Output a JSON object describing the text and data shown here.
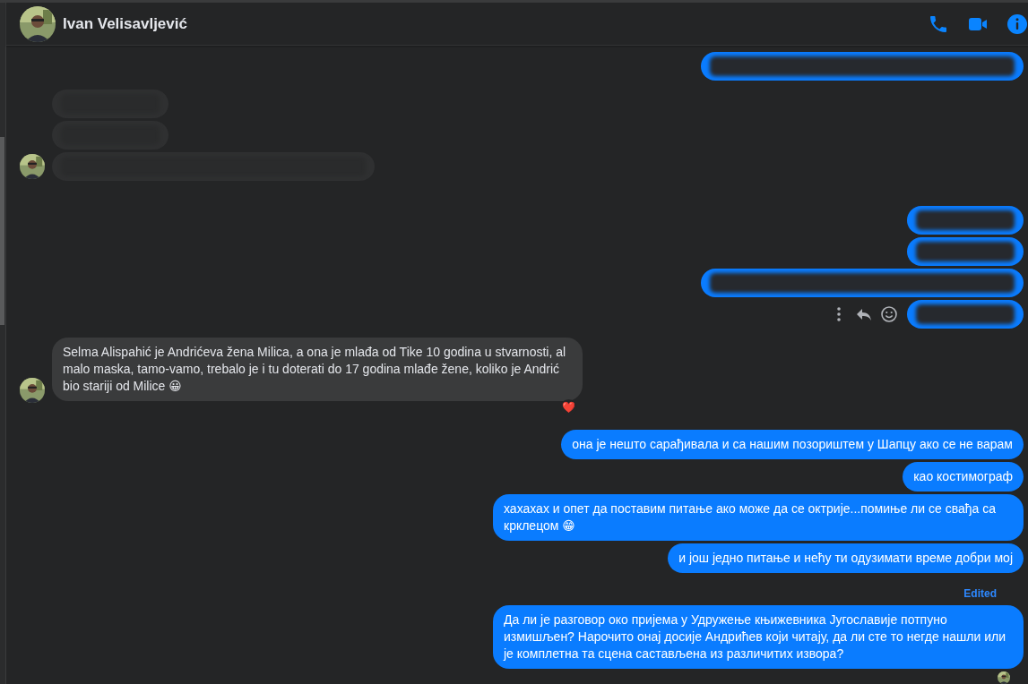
{
  "header": {
    "title": "Ivan Velisavljević",
    "actions": [
      {
        "kind": "phone"
      },
      {
        "kind": "video"
      },
      {
        "kind": "info"
      }
    ]
  },
  "groups": [
    {
      "outgoing": true,
      "messages": [
        {
          "kind": "redacted",
          "wide": true
        }
      ]
    },
    {
      "outgoing": false,
      "messages": [
        {
          "kind": "redacted",
          "wide": false
        },
        {
          "kind": "redacted",
          "wide": false
        },
        {
          "kind": "redacted",
          "wide": true
        }
      ]
    },
    {
      "outgoing": true,
      "messages": [
        {
          "kind": "redacted",
          "wide": false
        },
        {
          "kind": "redacted",
          "wide": false
        },
        {
          "kind": "redacted",
          "wide": true
        },
        {
          "kind": "redacted",
          "wide": false,
          "hover_actions": true
        }
      ]
    },
    {
      "outgoing": false,
      "messages": [
        {
          "kind": "text",
          "text": "Selma Alispahić je Andrićeva žena Milica, a ona je mlađa od Tike 10 godina u stvarnosti, al malo maska, tamo-vamo, trebalo je i tu doterati do 17 godina mlađe žene, koliko je Andrić bio stariji od Milice 😀",
          "reaction": "❤️"
        }
      ]
    },
    {
      "outgoing": true,
      "messages": [
        {
          "kind": "text",
          "text": "она је нешто сарађивала и са нашим позориштем у Шапцу ако се не варам"
        },
        {
          "kind": "text",
          "text": "као костимограф"
        },
        {
          "kind": "text",
          "text": "хахахах и опет да поставим питање ако може да се октрије...помиње ли се свађа са крклецом 😁"
        },
        {
          "kind": "text",
          "text": "и још једно питање и нећу ти одузимати време добри мој"
        }
      ]
    },
    {
      "outgoing": true,
      "label": "Edited",
      "seen": true,
      "messages": [
        {
          "kind": "text",
          "text": "Да ли је разговор око пријема у Удружење књижевника Југославије потпуно измишљен? Нарочито онај досије Андрићев који читају, да ли сте то негде нашли или је комплетна та сцена састављена из различитих извора?"
        }
      ]
    }
  ]
}
